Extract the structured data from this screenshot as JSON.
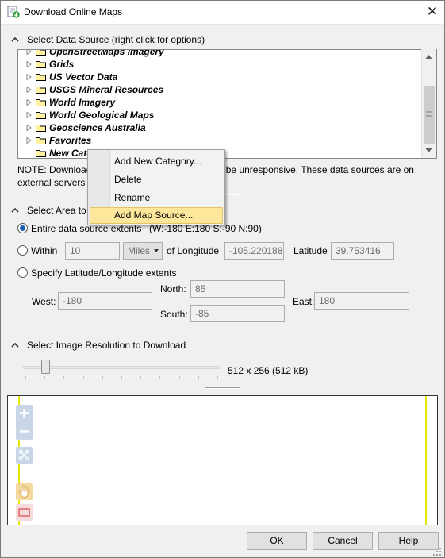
{
  "window": {
    "title": "Download Online Maps",
    "close_label": "✕"
  },
  "data_source": {
    "header": "Select Data Source (right click for options)",
    "items": [
      {
        "label": "OpenStreetMaps Imagery"
      },
      {
        "label": "Grids"
      },
      {
        "label": "US Vector Data"
      },
      {
        "label": "USGS Mineral Resources"
      },
      {
        "label": "World Imagery"
      },
      {
        "label": "World Geological Maps"
      },
      {
        "label": "Geoscience Australia"
      },
      {
        "label": "Favorites"
      },
      {
        "label": "New Cate"
      }
    ],
    "note_line1_a": "NOTE: Download",
    "note_line1_b": "y be unresponsive.  These data sources are on",
    "note_line2": "external servers"
  },
  "context_menu": {
    "items": [
      {
        "label": "Add New Category..."
      },
      {
        "label": "Delete"
      },
      {
        "label": "Rename"
      },
      {
        "label": "Add Map Source...",
        "highlighted": true
      }
    ]
  },
  "area": {
    "header": "Select Area to",
    "entire_label": "Entire data source extents",
    "entire_extents": "(W:-180 E:180 S:-90 N:90)",
    "within_label": "Within",
    "within_value": "10",
    "units_value": "Miles",
    "of_longitude_label": "of Longitude",
    "longitude_value": "-105.220188",
    "latitude_label": "Latitude",
    "latitude_value": "39.753416",
    "specify_label": "Specify Latitude/Longitude extents",
    "north_label": "North:",
    "north_value": "85",
    "west_label": "West:",
    "west_value": "-180",
    "east_label": "East:",
    "east_value": "180",
    "south_label": "South:",
    "south_value": "-85"
  },
  "resolution": {
    "header": "Select Image Resolution to Download",
    "value_text": "512 x 256  (512 kB)",
    "slider_level": 0.1
  },
  "buttons": {
    "ok": "OK",
    "cancel": "Cancel",
    "help": "Help"
  },
  "colors": {
    "accent": "#1a5fb4",
    "highlight": "#fde79b",
    "map_line": "#e6e600"
  }
}
